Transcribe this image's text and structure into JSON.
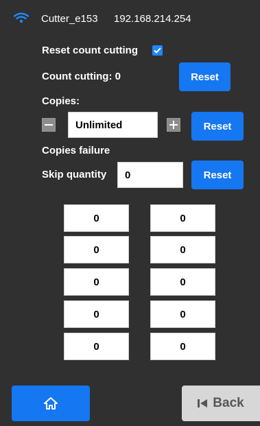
{
  "header": {
    "device_name": "Cutter_e153",
    "ip_address": "192.168.214.254"
  },
  "reset_count": {
    "label": "Reset count cutting",
    "checked": true
  },
  "count_cutting": {
    "label": "Count cutting: 0",
    "reset_label": "Reset"
  },
  "copies": {
    "label": "Copies:",
    "value": "Unlimited",
    "reset_label": "Reset"
  },
  "copies_failure": {
    "label": "Copies failure"
  },
  "skip": {
    "label": "Skip quantity",
    "value": "0",
    "reset_label": "Reset"
  },
  "grid": {
    "left": [
      "0",
      "0",
      "0",
      "0",
      "0"
    ],
    "right": [
      "0",
      "0",
      "0",
      "0",
      "0"
    ]
  },
  "footer": {
    "back_label": "Back"
  },
  "colors": {
    "background": "#303030",
    "accent": "#1577f2",
    "back_button": "#d7d7d7"
  }
}
